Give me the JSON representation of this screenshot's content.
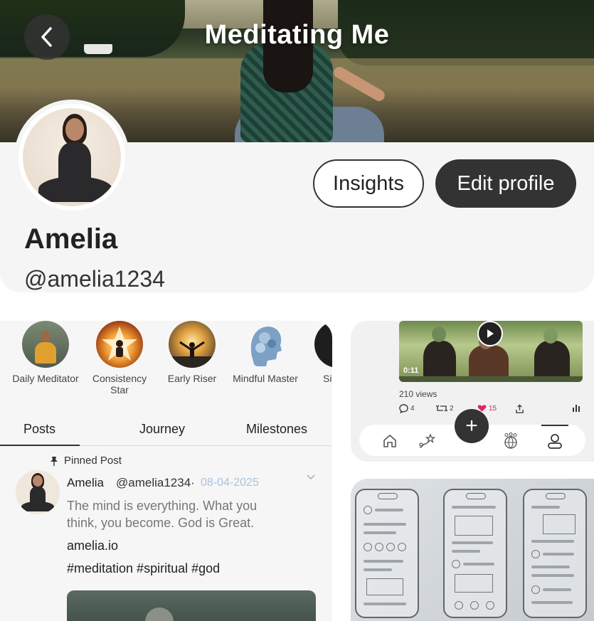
{
  "header": {
    "title": "Meditating Me",
    "back_label": "Back"
  },
  "profile": {
    "name": "Amelia",
    "handle": "@amelia1234",
    "insights_label": "Insights",
    "edit_label": "Edit profile"
  },
  "badges": [
    {
      "label": "Daily Meditator"
    },
    {
      "label": "Consistency Star"
    },
    {
      "label": "Early Riser"
    },
    {
      "label": "Mindful Master"
    },
    {
      "label": "Sil Se"
    }
  ],
  "tabs": [
    {
      "label": "Posts",
      "active": true
    },
    {
      "label": "Journey"
    },
    {
      "label": "Milestones"
    }
  ],
  "post": {
    "pinned_label": "Pinned Post",
    "author": "Amelia",
    "handle": "@amelia1234·",
    "date": "08-04-2025",
    "text": "The mind is everything. What you think, you become. God is Great.",
    "link": "amelia.io",
    "tags": "#meditation #spiritual #god"
  },
  "video_post": {
    "duration": "0:11",
    "views": "210 views",
    "comments": "4",
    "reposts": "2",
    "likes": "15"
  },
  "nav": {
    "fab_label": "+"
  },
  "colors": {
    "primary_dark": "#333333",
    "like": "#e0245e",
    "date": "#a8c4e0"
  }
}
